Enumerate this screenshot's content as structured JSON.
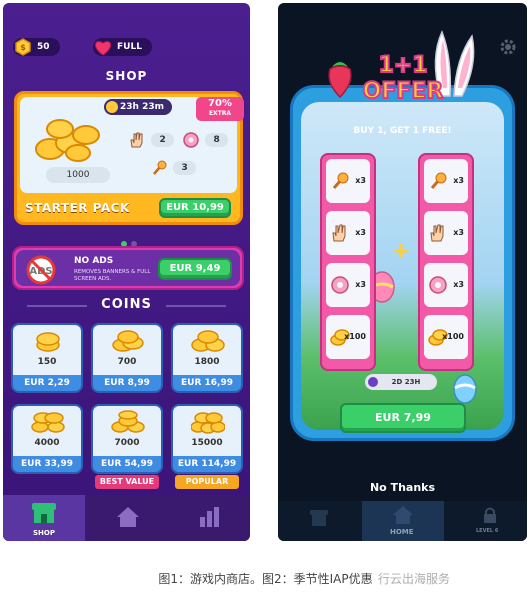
{
  "shop": {
    "coins_balance": "50",
    "lives_status": "FULL",
    "title": "SHOP",
    "starter_pack": {
      "timer": "23h 23m",
      "badge_percent": "70%",
      "badge_label": "EXTRA",
      "coins": "1000",
      "hands": "2",
      "donuts": "8",
      "spoons": "3",
      "label": "STARTER PACK",
      "price": "EUR 10,99"
    },
    "no_ads": {
      "icon_text": "ADS",
      "title": "NO ADS",
      "subtitle": "REMOVES BANNERS & FULL SCREEN ADS.",
      "price": "EUR 9,49"
    },
    "coins_title": "COINS",
    "coin_packs": [
      {
        "amount": "150",
        "price": "EUR 2,29",
        "tag": ""
      },
      {
        "amount": "700",
        "price": "EUR 8,99",
        "tag": ""
      },
      {
        "amount": "1800",
        "price": "EUR 16,99",
        "tag": ""
      },
      {
        "amount": "4000",
        "price": "EUR 33,99",
        "tag": ""
      },
      {
        "amount": "7000",
        "price": "EUR 54,99",
        "tag": "BEST VALUE"
      },
      {
        "amount": "15000",
        "price": "EUR 114,99",
        "tag": "POPULAR"
      }
    ],
    "nav": {
      "shop": "SHOP"
    },
    "colors": {
      "background": "#4b1f8f",
      "accent_green": "#3bcf6a",
      "tile_blue": "#3e8de2",
      "badge_pink": "#f2468b"
    }
  },
  "offer": {
    "title": "1+1 OFFER",
    "subtitle": "BUY 1, GET 1 FREE!",
    "left_items": [
      {
        "icon": "spoon-icon",
        "qty": "x3"
      },
      {
        "icon": "hand-icon",
        "qty": "x3"
      },
      {
        "icon": "donut-icon",
        "qty": "x3"
      },
      {
        "icon": "coins-icon",
        "qty": "x100"
      }
    ],
    "right_items": [
      {
        "icon": "spoon-icon",
        "qty": "x3"
      },
      {
        "icon": "hand-icon",
        "qty": "x3"
      },
      {
        "icon": "donut-icon",
        "qty": "x3"
      },
      {
        "icon": "coins-icon",
        "qty": "x100"
      }
    ],
    "timer": "2D 23H",
    "price": "EUR 7,99",
    "decline": "No Thanks",
    "nav": {
      "home": "HOME",
      "level": "LEVEL 6"
    }
  },
  "caption": "图1：游戏内商店。图2：季节性IAP优惠",
  "watermark": "行云出海服务"
}
